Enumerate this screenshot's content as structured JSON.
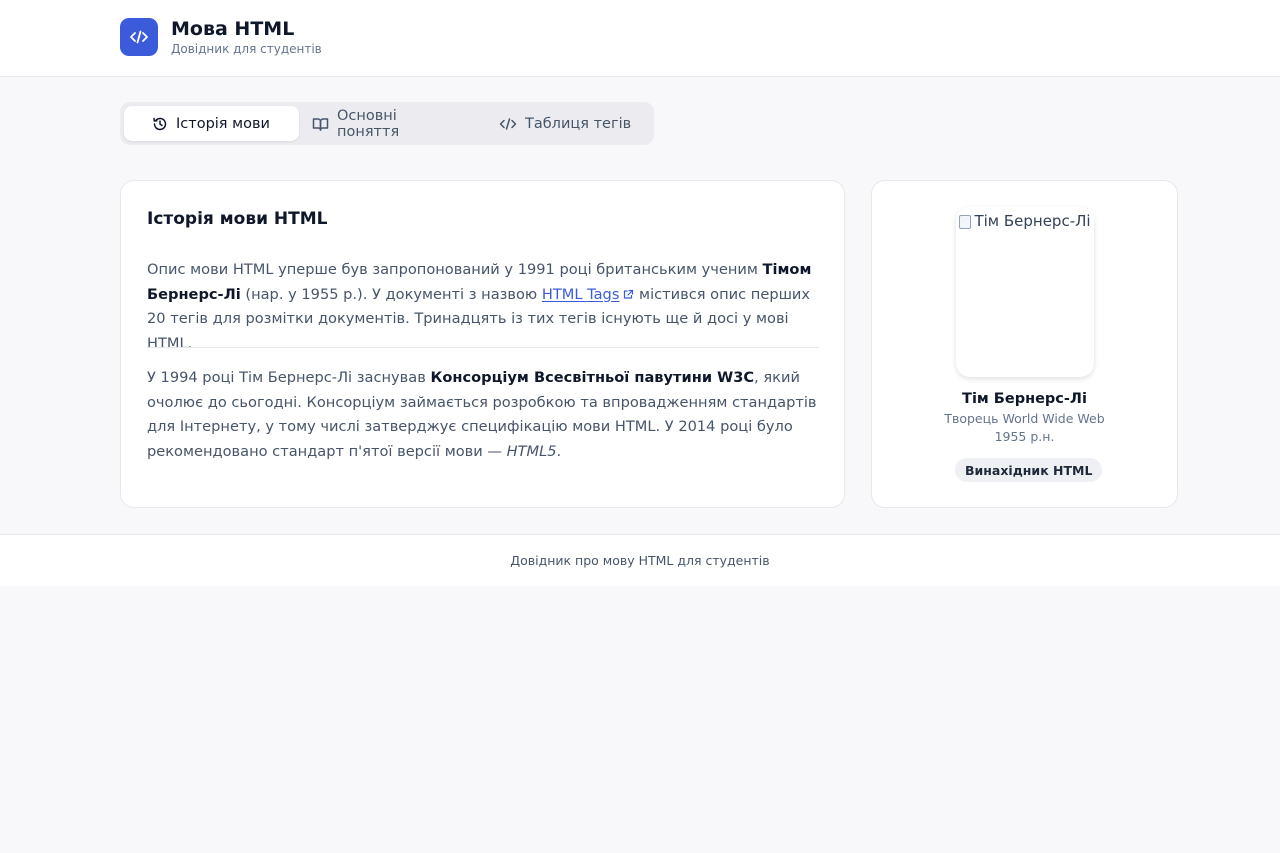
{
  "header": {
    "title": "Мова HTML",
    "subtitle": "Довідник для студентів",
    "logo_icon": "code-icon",
    "accent": "#3b5bdb"
  },
  "tabs": [
    {
      "label": "Історія мови",
      "icon": "history-icon",
      "active": true
    },
    {
      "label": "Основні поняття",
      "icon": "book-icon",
      "active": false
    },
    {
      "label": "Таблиця тегів",
      "icon": "code-icon",
      "active": false
    }
  ],
  "main": {
    "title": "Історія мови HTML",
    "p1": {
      "t1": "Опис мови HTML уперше був запропонований у 1991 році британським ученим ",
      "b1": "Тімом Бернерс-Лі",
      "t2": " (нар. у 1955 р.). У документі з назвою ",
      "link": "HTML Tags",
      "t3": " містився опис перших 20 тегів для розмітки документів. Тринадцять із тих тегів існують ще й досі у мові HTML."
    },
    "p2": {
      "t1": "У 1994 році Тім Бернерс-Лі заснував ",
      "b1": "Консорціум Всесвітньої павутини W3C",
      "t2": ", який очолює до сьогодні. Консорціум займається розробкою та впровадженням стандартів для Інтернету, у тому числі затверджує специфікацію мови HTML. У 2014 році було рекомендовано стандарт п'ятої версії мови — ",
      "i1": "HTML5",
      "t3": "."
    }
  },
  "side": {
    "photo_alt": "Тім Бернерс-Лі",
    "name": "Тім Бернерс-Лі",
    "role": "Творець World Wide Web",
    "year": "1955 р.н.",
    "badge": "Винахідник HTML"
  },
  "footer": {
    "text": "Довідник про мову HTML для студентів"
  }
}
